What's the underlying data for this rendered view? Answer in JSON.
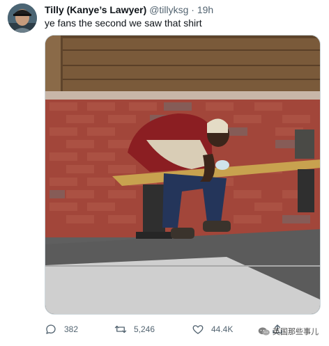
{
  "tweet": {
    "author_name": "Tilly (Kanye’s Lawyer)",
    "handle": "@tillyksg",
    "separator": "·",
    "time": "19h",
    "text": "ye fans the second we saw that shirt"
  },
  "media": {
    "description_icon": "photo"
  },
  "actions": {
    "reply_count": "382",
    "retweet_count": "5,246",
    "like_count": "44.4K"
  },
  "icons": {
    "reply": "comment-bubble-icon",
    "retweet": "retweet-arrows-icon",
    "like": "heart-icon",
    "share": "share-upload-icon"
  },
  "watermark": {
    "text": "英国那些事儿"
  },
  "colors": {
    "secondary_text": "#536471",
    "primary_text": "#0f1419"
  }
}
